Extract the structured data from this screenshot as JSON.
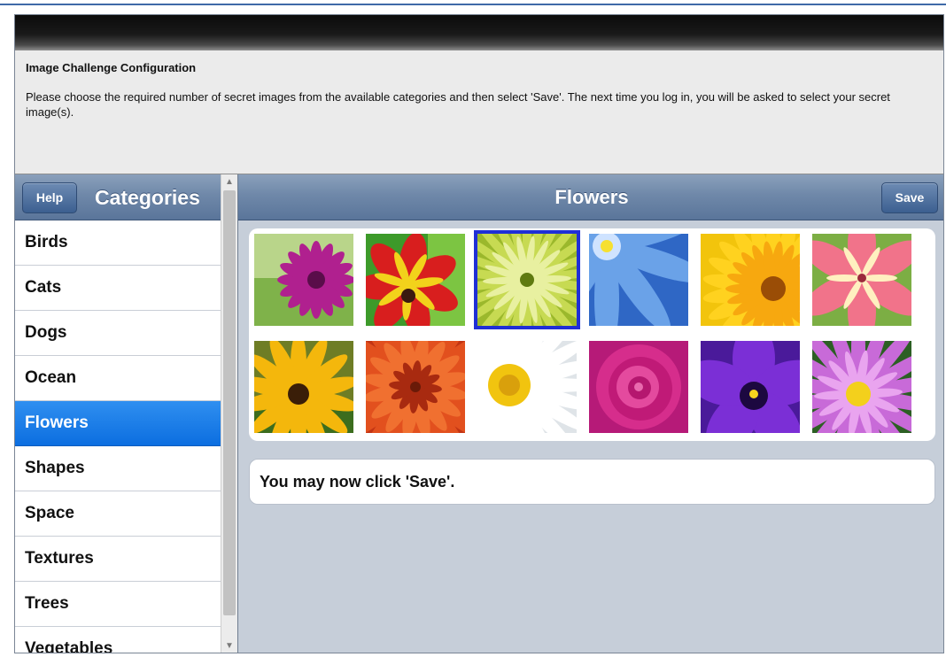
{
  "intro": {
    "title": "Image Challenge Configuration",
    "text": "Please choose the required number of secret images from the available categories and then select 'Save'. The next time you log in, you will be asked to select your secret image(s)."
  },
  "sidebar": {
    "help_label": "Help",
    "title": "Categories",
    "items": [
      {
        "label": "Birds",
        "selected": false
      },
      {
        "label": "Cats",
        "selected": false
      },
      {
        "label": "Dogs",
        "selected": false
      },
      {
        "label": "Ocean",
        "selected": false
      },
      {
        "label": "Flowers",
        "selected": true
      },
      {
        "label": "Shapes",
        "selected": false
      },
      {
        "label": "Space",
        "selected": false
      },
      {
        "label": "Textures",
        "selected": false
      },
      {
        "label": "Trees",
        "selected": false
      },
      {
        "label": "Vegetables",
        "selected": false
      }
    ]
  },
  "main": {
    "title": "Flowers",
    "save_label": "Save",
    "message": "You may now click 'Save'.",
    "images": [
      {
        "name": "purple-daisy",
        "selected": false
      },
      {
        "name": "red-tulip",
        "selected": false
      },
      {
        "name": "green-chrysanthemum",
        "selected": true
      },
      {
        "name": "blue-abstract-flower",
        "selected": false
      },
      {
        "name": "yellow-gerbera",
        "selected": false
      },
      {
        "name": "pink-lily",
        "selected": false
      },
      {
        "name": "black-eyed-susan",
        "selected": false
      },
      {
        "name": "orange-dahlia",
        "selected": false
      },
      {
        "name": "white-daisy",
        "selected": false
      },
      {
        "name": "pink-rose",
        "selected": false
      },
      {
        "name": "purple-pansy",
        "selected": false
      },
      {
        "name": "purple-water-lily",
        "selected": false
      }
    ]
  },
  "colors": {
    "accent": "#1f2fd6",
    "selected_category": "#1a7ee8",
    "header_blue": "#6f88a9"
  }
}
